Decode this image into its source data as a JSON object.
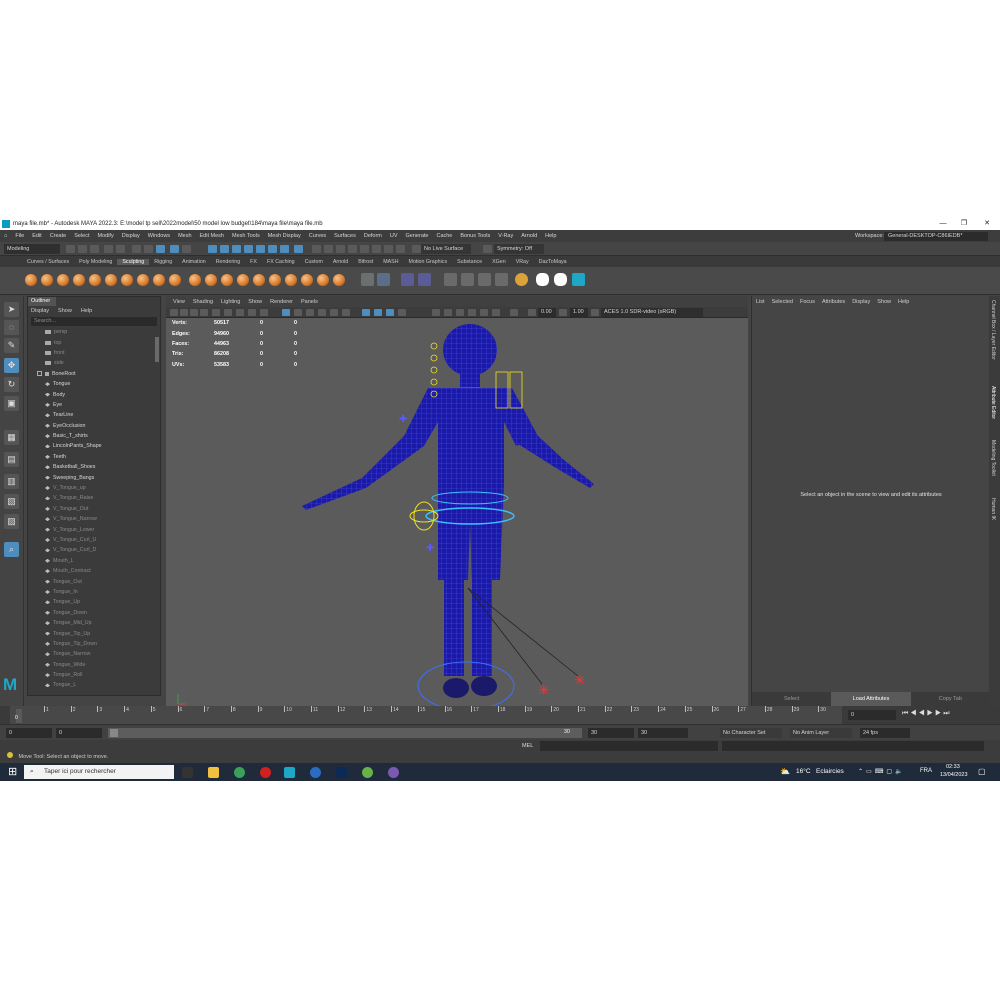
{
  "window": {
    "title": "maya file.mb* - Autodesk MAYA 2022.3: E:\\model tp sell\\2022model\\50 model low budget\\184\\maya file\\maya file.mb",
    "minimize": "—",
    "maximize": "❐",
    "close": "✕"
  },
  "menubar": [
    "File",
    "Edit",
    "Create",
    "Select",
    "Modify",
    "Display",
    "Windows",
    "Mesh",
    "Edit Mesh",
    "Mesh Tools",
    "Mesh Display",
    "Curves",
    "Surfaces",
    "Deform",
    "UV",
    "Generate",
    "Cache",
    "Bonus Tools",
    "V-Ray",
    "Arnold",
    "Help"
  ],
  "workspace": {
    "label": "Workspace:",
    "value": "General-DESKTOP-C86IEDB*"
  },
  "statusline": {
    "mode": "Modeling",
    "live_surface": "No Live Surface",
    "symmetry": "Symmetry: Off"
  },
  "shelf_tabs": [
    "Curves / Surfaces",
    "Poly Modeling",
    "Sculpting",
    "Rigging",
    "Animation",
    "Rendering",
    "FX",
    "FX Caching",
    "Custom",
    "Arnold",
    "Bifrost",
    "MASH",
    "Motion Graphics",
    "Substance",
    "XGen",
    "VRay",
    "DazToMaya"
  ],
  "shelf_active": "Sculpting",
  "outliner": {
    "title": "Outliner",
    "menu": [
      "Display",
      "Show",
      "Help"
    ],
    "search_placeholder": "Search...",
    "cameras": [
      "persp",
      "top",
      "front",
      "side"
    ],
    "bone_root": "BoneRoot",
    "items": [
      "Tongue",
      "Body",
      "Eye",
      "TearLine",
      "EyeOcclusion",
      "Basic_T_shirts",
      "LincolnPants_Shape",
      "Teeth",
      "Basketball_Shoes",
      "Sweeping_Bangs"
    ],
    "dim_items": [
      "V_Tongue_up",
      "V_Tongue_Raise",
      "V_Tongue_Out",
      "V_Tongue_Narrow",
      "V_Tongue_Lower",
      "V_Tongue_Curl_U",
      "V_Tongue_Curl_D",
      "Mouth_L",
      "Mouth_Contract",
      "Tongue_Out",
      "Tongue_In",
      "Tongue_Up",
      "Tongue_Down",
      "Tongue_Mid_Up",
      "Tongue_Tip_Up",
      "Tongue_Tip_Down",
      "Tongue_Narrow",
      "Tongue_Wide",
      "Tongue_Roll",
      "Tongue_L"
    ]
  },
  "viewport": {
    "menu": [
      "View",
      "Shading",
      "Lighting",
      "Show",
      "Renderer",
      "Panels"
    ],
    "exposure": "0.00",
    "gamma": "1.00",
    "colorspace": "ACES 1.0 SDR-video (sRGB)",
    "hud": [
      {
        "label": "Verts:",
        "value": "50517",
        "sel": "0",
        "comp": "0"
      },
      {
        "label": "Edges:",
        "value": "94960",
        "sel": "0",
        "comp": "0"
      },
      {
        "label": "Faces:",
        "value": "44963",
        "sel": "0",
        "comp": "0"
      },
      {
        "label": "Tris:",
        "value": "86208",
        "sel": "0",
        "comp": "0"
      },
      {
        "label": "UVs:",
        "value": "53583",
        "sel": "0",
        "comp": "0"
      }
    ]
  },
  "attribute_editor": {
    "menu": [
      "List",
      "Selected",
      "Focus",
      "Attributes",
      "Display",
      "Show",
      "Help"
    ],
    "message": "Select an object in the scene to view and edit its attributes",
    "buttons": [
      "Select",
      "Load Attributes",
      "Copy Tab"
    ]
  },
  "side_tabs": [
    "Channel Box / Layer Editor",
    "Attribute Editor",
    "Modeling Toolkit",
    "Human IK"
  ],
  "timeline": {
    "ticks": [
      "1",
      "2",
      "3",
      "4",
      "5",
      "6",
      "7",
      "8",
      "9",
      "10",
      "11",
      "12",
      "13",
      "14",
      "15",
      "16",
      "17",
      "18",
      "19",
      "20",
      "21",
      "22",
      "23",
      "24",
      "25",
      "26",
      "27",
      "28",
      "29",
      "30"
    ],
    "current_frame": "0",
    "frame_marker": "0"
  },
  "range": {
    "start": "0",
    "playback_start": "0",
    "range_end_label": "30",
    "playback_end": "30",
    "end": "30",
    "character_set": "No Character Set",
    "anim_layer": "No Anim Layer",
    "fps": "24 fps"
  },
  "cmdline": {
    "lang": "MEL"
  },
  "helpline": {
    "text": "Move Tool: Select an object to move."
  },
  "taskbar": {
    "search_placeholder": "Taper ici pour rechercher",
    "temperature": "16°C",
    "weather": "Eclaircies",
    "language": "FRA",
    "time": "02:33",
    "date": "13/04/2023"
  }
}
